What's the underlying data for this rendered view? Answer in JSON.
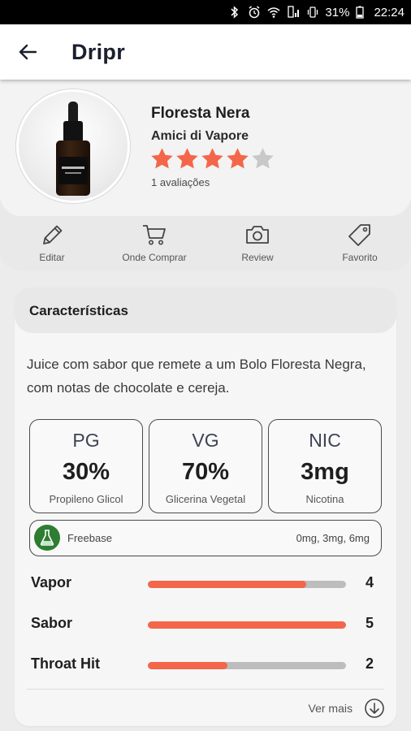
{
  "status_bar": {
    "battery": "31%",
    "time": "22:24",
    "icons": [
      "bluetooth-icon",
      "alarm-icon",
      "wifi-icon",
      "signal-icon",
      "vibrate-icon",
      "battery-icon"
    ]
  },
  "app_bar": {
    "title": "Dripr",
    "back_icon": "arrow-left-icon"
  },
  "product": {
    "name": "Floresta Nera",
    "brand": "Amici di Vapore",
    "rating": 4,
    "rating_max": 5,
    "reviews_text": "1 avaliações",
    "colors": {
      "star_filled": "#f4664a",
      "star_empty": "#c8c8c8"
    }
  },
  "actions": [
    {
      "label": "Editar",
      "icon": "pencil-icon"
    },
    {
      "label": "Onde Comprar",
      "icon": "cart-icon"
    },
    {
      "label": "Review",
      "icon": "camera-icon"
    },
    {
      "label": "Favorito",
      "icon": "tag-icon"
    }
  ],
  "characteristics": {
    "title": "Características",
    "description": "Juice com sabor que remete a um Bolo Floresta Negra, com notas de chocolate e cereja.",
    "stats": [
      {
        "key": "PG",
        "value": "30%",
        "desc": "Propileno Glicol"
      },
      {
        "key": "VG",
        "value": "70%",
        "desc": "Glicerina Vegetal"
      },
      {
        "key": "NIC",
        "value": "3mg",
        "desc": "Nicotina"
      }
    ],
    "nicotine": {
      "type": "Freebase",
      "options": "0mg, 3mg, 6mg",
      "icon": "flask-icon"
    },
    "ratings": [
      {
        "label": "Vapor",
        "value": "4",
        "level": 0.8
      },
      {
        "label": "Sabor",
        "value": "5",
        "level": 1.0
      },
      {
        "label": "Throat Hit",
        "value": "2",
        "level": 0.4
      }
    ],
    "colors": {
      "bar_fill": "#f4664a",
      "bar_track": "#bdbdbd"
    },
    "more_label": "Ver mais",
    "more_icon": "arrow-down-circle-icon"
  }
}
